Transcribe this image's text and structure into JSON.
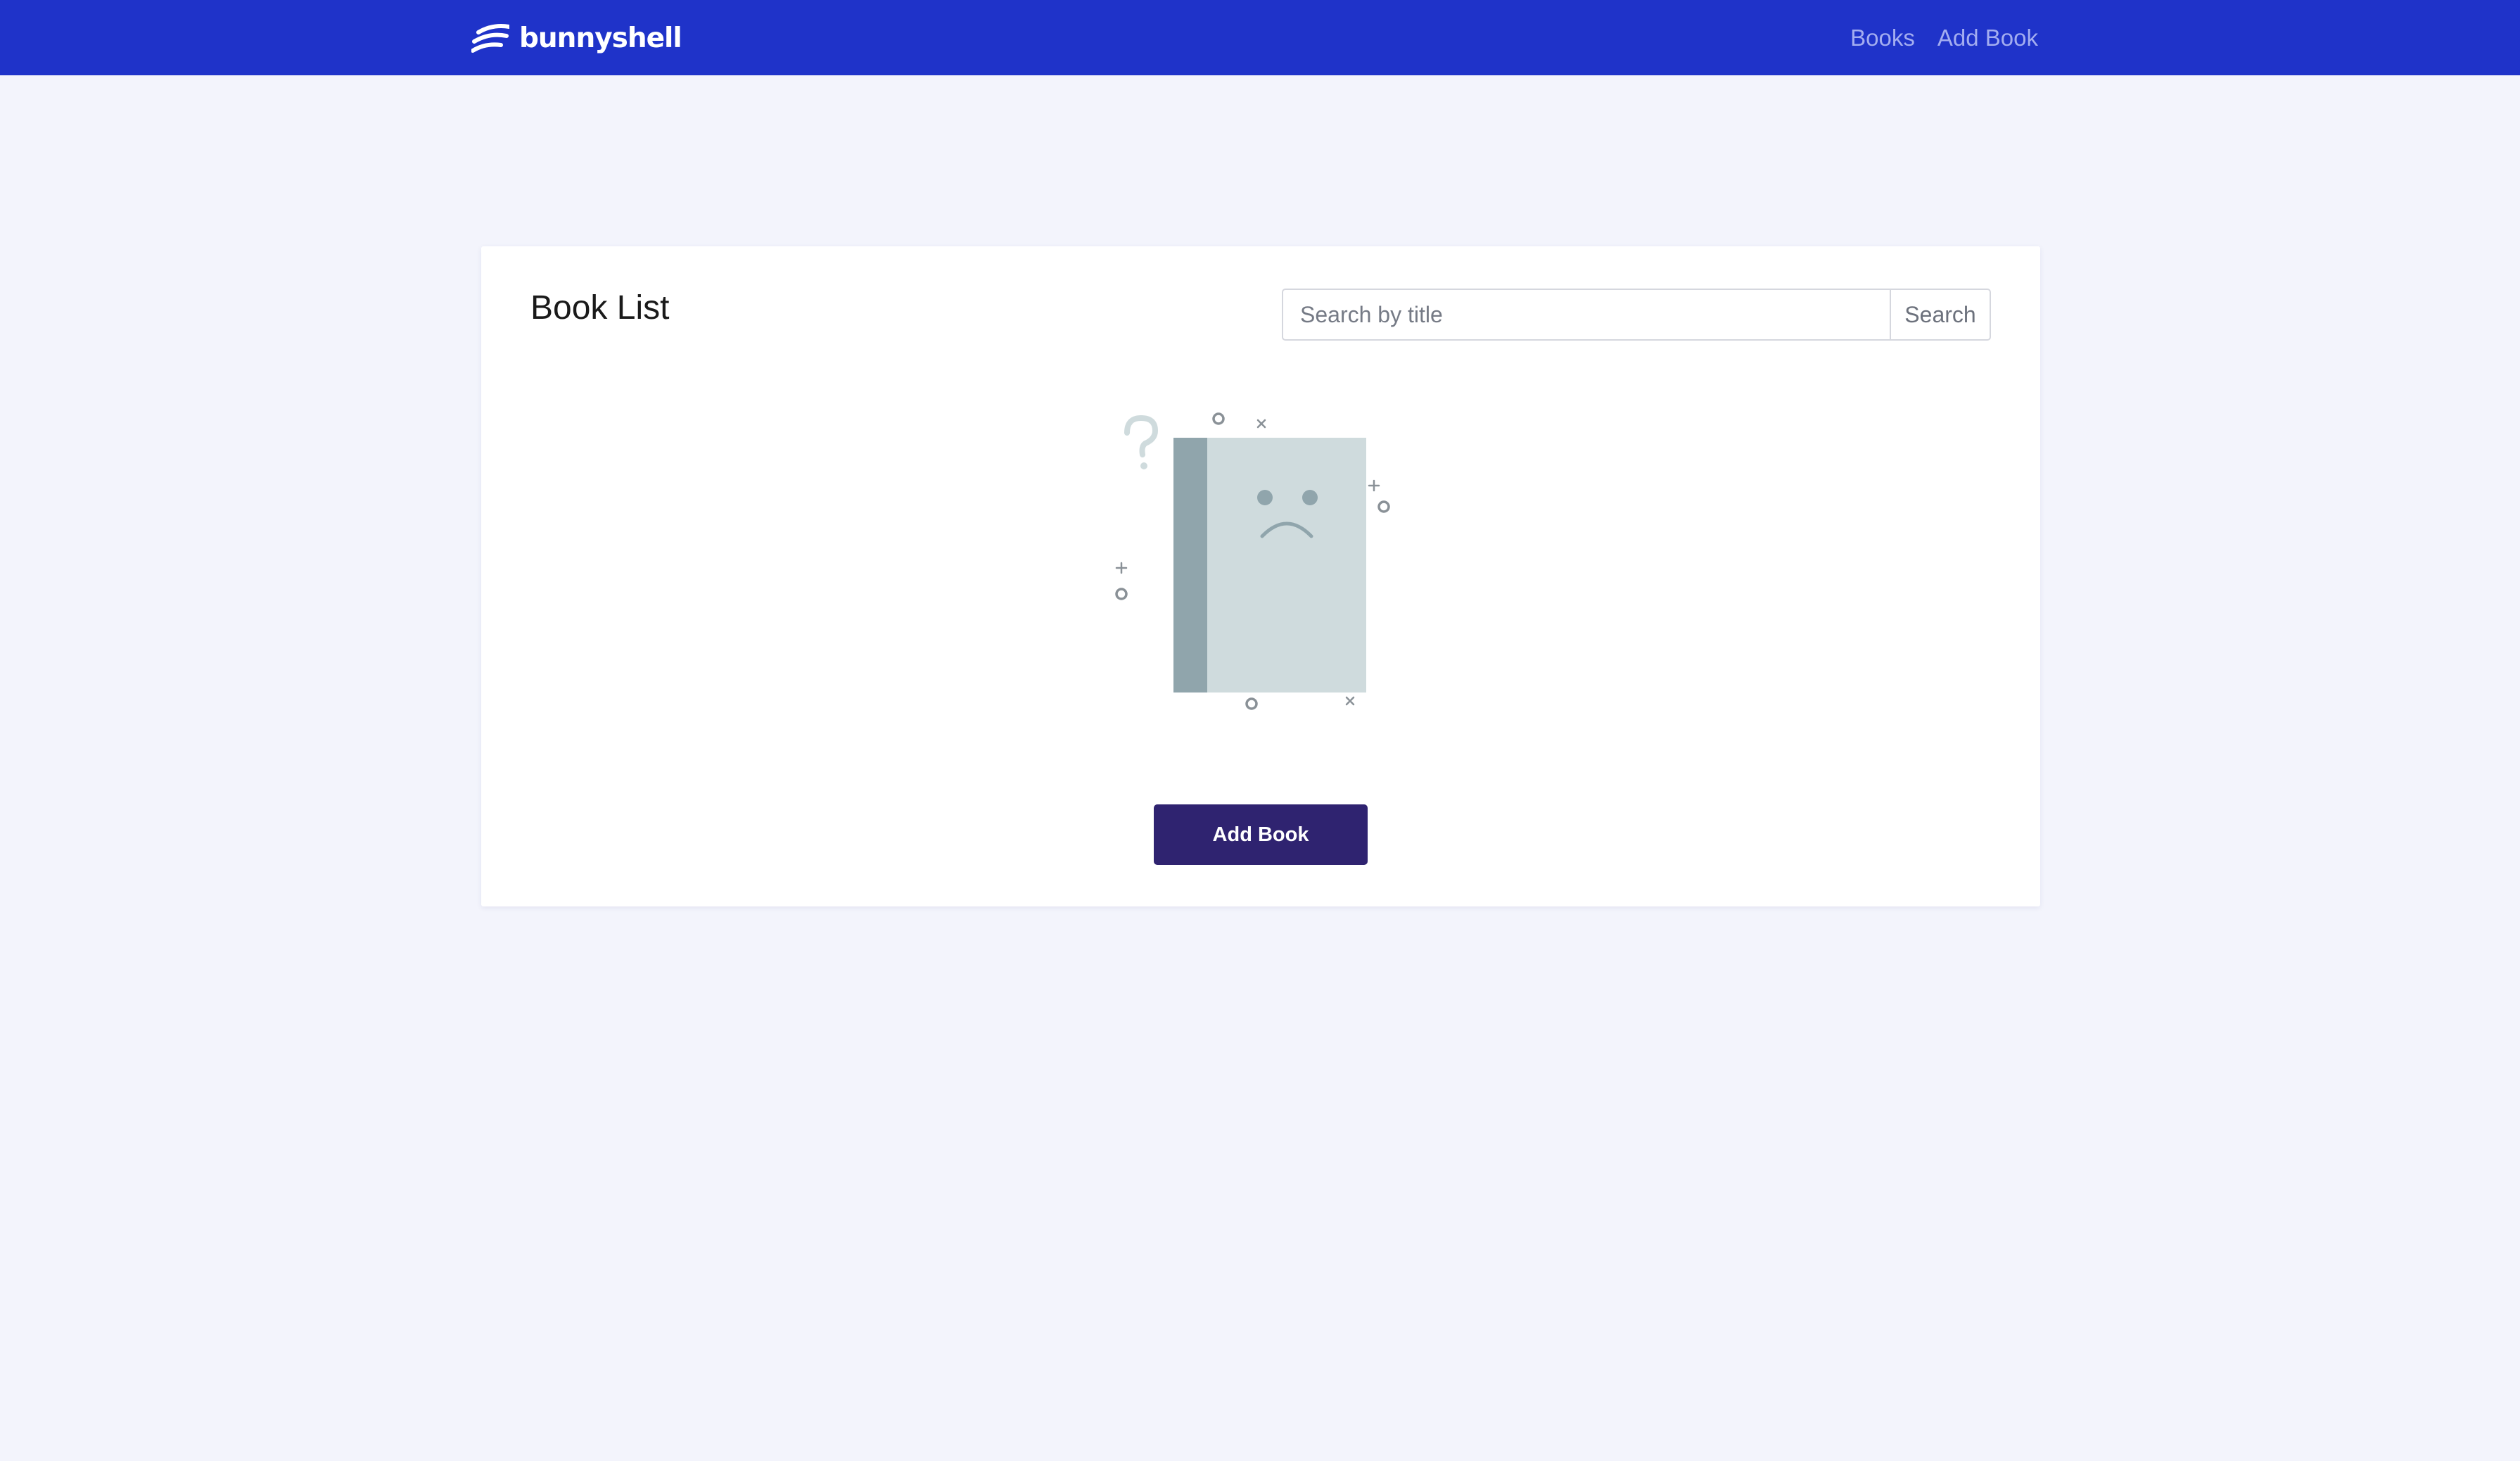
{
  "navbar": {
    "brand": "bunnyshell",
    "brand_icon": "bunnyshell-logo-icon",
    "links": [
      {
        "label": "Books"
      },
      {
        "label": "Add Book"
      }
    ]
  },
  "main": {
    "title": "Book List",
    "search": {
      "placeholder": "Search by title",
      "value": "",
      "button_label": "Search"
    },
    "empty_state_icon": "sad-book-icon",
    "add_button_label": "Add Book"
  },
  "colors": {
    "navbar": "#1f33c9",
    "nav_link": "#a3adf0",
    "background": "#f3f4fc",
    "primary_button": "#2f2370",
    "illustration_cover": "#cfdbdd",
    "illustration_spine": "#90a5ac"
  }
}
